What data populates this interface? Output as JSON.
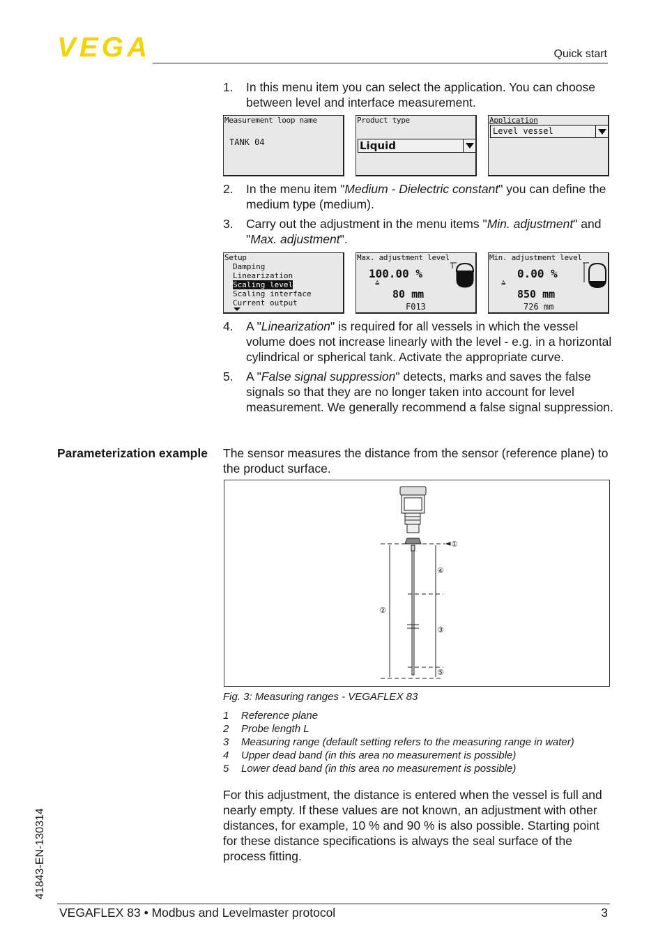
{
  "header": {
    "logo": "VEGA",
    "section": "Quick start",
    "brand_color": "#f3d400"
  },
  "steps": [
    {
      "num": "1.",
      "text": "In this menu item you can select the application. You can choose between level and interface measurement."
    },
    {
      "num": "2.",
      "pre": "In the menu item \"",
      "em": "Medium - Dielectric constant",
      "post": "\" you can define the medium type (medium)."
    },
    {
      "num": "3.",
      "pre": "Carry out the adjustment in the menu items \"",
      "em": "Min. adjustment",
      "mid": "\" and \"",
      "em2": "Max. adjustment",
      "post": "\"."
    },
    {
      "num": "4.",
      "pre": "A \"",
      "em": "Linearization",
      "post": "\" is required for all vessels in which the vessel volume does not increase linearly with the level - e.g. in a horizontal cylindrical or spherical tank. Activate the appropriate curve."
    },
    {
      "num": "5.",
      "pre": "A \"",
      "em": "False signal suppression",
      "post": "\" detects, marks and saves the false signals so that they are no longer taken into account for level measurement. We generally recommend a false signal suppression."
    }
  ],
  "screens_row1": {
    "loop": {
      "title": "Measurement loop name",
      "value": "TANK 04"
    },
    "product": {
      "title": "Product type",
      "value": "Liquid"
    },
    "application": {
      "title": "Application",
      "value": "Level vessel"
    }
  },
  "screens_row2": {
    "setup": {
      "title": "Setup",
      "items": [
        "Damping",
        "Linearization",
        "Scaling level",
        "Scaling interface",
        "Current output"
      ],
      "selected": "Scaling level"
    },
    "max": {
      "title": "Max. adjustment level",
      "percent": "100.00 %",
      "equiv": "≙",
      "distance": "80 mm",
      "code": "F013"
    },
    "min": {
      "title": "Min. adjustment level",
      "percent": "0.00 %",
      "equiv": "≙",
      "distance": "850 mm",
      "measured": "726 mm"
    }
  },
  "example": {
    "label": "Parameterization example",
    "text": "The sensor measures the distance from the sensor (reference plane) to the product surface."
  },
  "figure": {
    "markers": [
      "①",
      "②",
      "③",
      "④",
      "⑤"
    ],
    "caption": "Fig. 3: Measuring ranges - VEGAFLEX 83",
    "legend": [
      {
        "n": "1",
        "t": "Reference plane"
      },
      {
        "n": "2",
        "t": "Probe length L"
      },
      {
        "n": "3",
        "t": "Measuring range (default setting refers to the measuring range in water)"
      },
      {
        "n": "4",
        "t": "Upper dead band (in this area no measurement is possible)"
      },
      {
        "n": "5",
        "t": "Lower dead band (in this area no measurement is possible)"
      }
    ]
  },
  "closing": "For this adjustment, the distance is entered when the vessel is full and nearly empty. If these values are not known, an adjustment with other distances, for example, 10 % and 90 % is also possible. Starting point for these distance specifications is always the seal surface of the process fitting.",
  "footer": {
    "doc_id": "41843-EN-130314",
    "title": "VEGAFLEX 83 • Modbus and Levelmaster protocol",
    "page": "3"
  }
}
